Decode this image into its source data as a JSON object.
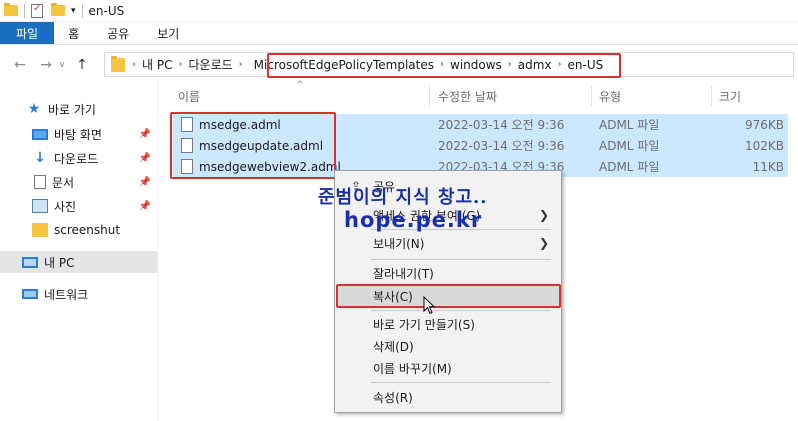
{
  "window": {
    "title": "en-US"
  },
  "ribbon": {
    "tabs": [
      "파일",
      "홈",
      "공유",
      "보기"
    ]
  },
  "address": {
    "crumbs": [
      "내 PC",
      "다운로드",
      "MicrosoftEdgePolicyTemplates",
      "windows",
      "admx",
      "en-US"
    ]
  },
  "sidebar": {
    "items": [
      {
        "label": "바로 가기",
        "icon": "star-icon"
      },
      {
        "label": "바탕 화면",
        "icon": "desktop-icon",
        "pinned": true
      },
      {
        "label": "다운로드",
        "icon": "download-icon",
        "pinned": true
      },
      {
        "label": "문서",
        "icon": "document-icon",
        "pinned": true
      },
      {
        "label": "사진",
        "icon": "pictures-icon",
        "pinned": true
      },
      {
        "label": "screenshut",
        "icon": "folder-icon"
      },
      {
        "label": "내 PC",
        "icon": "pc-icon",
        "selected": true
      },
      {
        "label": "네트워크",
        "icon": "network-icon"
      }
    ]
  },
  "columns": {
    "name": "이름",
    "modified": "수정한 날짜",
    "type": "유형",
    "size": "크기"
  },
  "files": [
    {
      "name": "msedge.adml",
      "modified": "2022-03-14 오전 9:36",
      "type": "ADML 파일",
      "size": "976KB"
    },
    {
      "name": "msedgeupdate.adml",
      "modified": "2022-03-14 오전 9:36",
      "type": "ADML 파일",
      "size": "102KB"
    },
    {
      "name": "msedgewebview2.adml",
      "modified": "2022-03-14 오전 9:36",
      "type": "ADML 파일",
      "size": "11KB"
    }
  ],
  "context_menu": {
    "share": "공유",
    "access": "액세스 권한 부여 (G)",
    "send_to": "보내기(N)",
    "cut": "잘라내기(T)",
    "copy": "복사(C)",
    "shortcut": "바로 가기 만들기(S)",
    "delete": "삭제(D)",
    "rename": "이름 바꾸기(M)",
    "properties": "속성(R)"
  },
  "watermark": {
    "line1": "준범이의 지식 창고..",
    "line2": "hope.pe.kr"
  },
  "colors": {
    "accent": "#1a6fc0",
    "selection": "#cce8ff",
    "highlight_box": "#d93030",
    "watermark": "#1b2fa8"
  }
}
